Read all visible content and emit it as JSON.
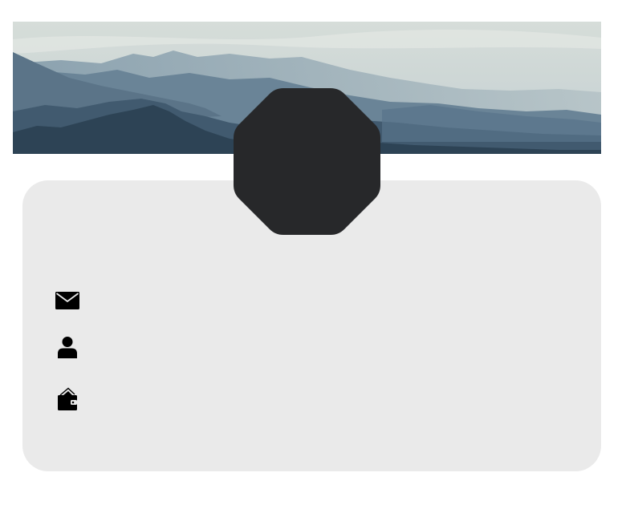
{
  "banner": {
    "image": "mountain-landscape",
    "colors": {
      "sky_top": "#d6ddd9",
      "sky_bottom": "#c9d3d4",
      "far_ridge": "#8fa5b2",
      "mid_ridge": "#6a8497",
      "near_ridge": "#415a6f",
      "front_ridge": "#2d4355"
    }
  },
  "card": {
    "background": "#eaeaea"
  },
  "avatar": {
    "shape": "octagon",
    "color": "#27282a"
  },
  "profile": {
    "email": {
      "icon": "envelope-icon",
      "value": ""
    },
    "username": {
      "icon": "user-icon",
      "value": ""
    },
    "wallet": {
      "icon": "wallet-icon",
      "value": ""
    }
  }
}
